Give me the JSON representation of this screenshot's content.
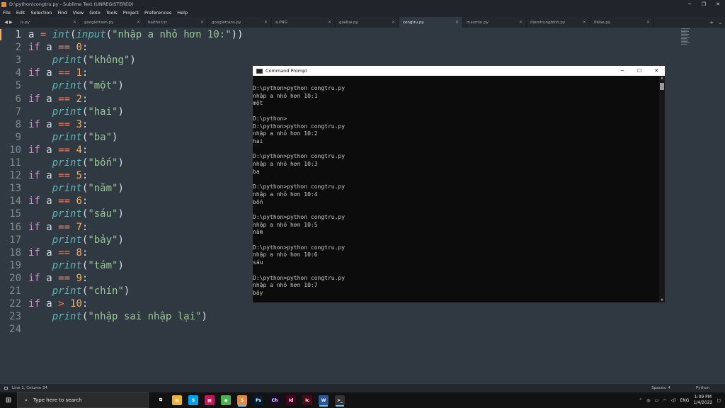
{
  "window": {
    "title": "D:\\python\\congtru.py - Sublime Text (UNREGISTERED)",
    "controls": [
      "─",
      "❐",
      "✕"
    ]
  },
  "menu": [
    "File",
    "Edit",
    "Selection",
    "Find",
    "View",
    "Goto",
    "Tools",
    "Project",
    "Preferences",
    "Help"
  ],
  "tabs": [
    {
      "label": "ls.py",
      "active": false
    },
    {
      "label": "googletrasn.py",
      "active": false
    },
    {
      "label": "baitho.txt",
      "active": false
    },
    {
      "label": "googletrans.py",
      "active": false
    },
    {
      "label": "a.PNG",
      "active": false
    },
    {
      "label": "giaibai.py",
      "active": false
    },
    {
      "label": "congtru.py",
      "active": true
    },
    {
      "label": "maxmin.py",
      "active": false
    },
    {
      "label": "diemtrungbinh.py",
      "active": false
    },
    {
      "label": "ifelse.py",
      "active": false
    }
  ],
  "editor": {
    "lines": [
      {
        "n": "1",
        "tokens": [
          [
            "plain",
            "a "
          ],
          [
            "op",
            "="
          ],
          [
            "plain",
            " "
          ],
          [
            "fn",
            "int"
          ],
          [
            "plain",
            "("
          ],
          [
            "fn",
            "input"
          ],
          [
            "plain",
            "("
          ],
          [
            "str",
            "\"nhập a nhỏ hơn 10:\""
          ],
          [
            "plain",
            "))"
          ]
        ]
      },
      {
        "n": "2",
        "tokens": [
          [
            "kw",
            "if"
          ],
          [
            "plain",
            " a "
          ],
          [
            "op",
            "=="
          ],
          [
            "plain",
            " "
          ],
          [
            "num",
            "0"
          ],
          [
            "plain",
            ":"
          ]
        ]
      },
      {
        "n": "3",
        "tokens": [
          [
            "plain",
            "    "
          ],
          [
            "fn",
            "print"
          ],
          [
            "plain",
            "("
          ],
          [
            "str",
            "\"không\""
          ],
          [
            "plain",
            ")"
          ]
        ]
      },
      {
        "n": "4",
        "tokens": [
          [
            "kw",
            "if"
          ],
          [
            "plain",
            " a "
          ],
          [
            "op",
            "=="
          ],
          [
            "plain",
            " "
          ],
          [
            "num",
            "1"
          ],
          [
            "plain",
            ":"
          ]
        ]
      },
      {
        "n": "5",
        "tokens": [
          [
            "plain",
            "    "
          ],
          [
            "fn",
            "print"
          ],
          [
            "plain",
            "("
          ],
          [
            "str",
            "\"một\""
          ],
          [
            "plain",
            ")"
          ]
        ]
      },
      {
        "n": "6",
        "tokens": [
          [
            "kw",
            "if"
          ],
          [
            "plain",
            " a "
          ],
          [
            "op",
            "=="
          ],
          [
            "plain",
            " "
          ],
          [
            "num",
            "2"
          ],
          [
            "plain",
            ":"
          ]
        ]
      },
      {
        "n": "7",
        "tokens": [
          [
            "plain",
            "    "
          ],
          [
            "fn",
            "print"
          ],
          [
            "plain",
            "("
          ],
          [
            "str",
            "\"hai\""
          ],
          [
            "plain",
            ")"
          ]
        ]
      },
      {
        "n": "8",
        "tokens": [
          [
            "kw",
            "if"
          ],
          [
            "plain",
            " a "
          ],
          [
            "op",
            "=="
          ],
          [
            "plain",
            " "
          ],
          [
            "num",
            "3"
          ],
          [
            "plain",
            ":"
          ]
        ]
      },
      {
        "n": "9",
        "tokens": [
          [
            "plain",
            "    "
          ],
          [
            "fn",
            "print"
          ],
          [
            "plain",
            "("
          ],
          [
            "str",
            "\"ba\""
          ],
          [
            "plain",
            ")"
          ]
        ]
      },
      {
        "n": "10",
        "tokens": [
          [
            "kw",
            "if"
          ],
          [
            "plain",
            " a "
          ],
          [
            "op",
            "=="
          ],
          [
            "plain",
            " "
          ],
          [
            "num",
            "4"
          ],
          [
            "plain",
            ":"
          ]
        ]
      },
      {
        "n": "11",
        "tokens": [
          [
            "plain",
            "    "
          ],
          [
            "fn",
            "print"
          ],
          [
            "plain",
            "("
          ],
          [
            "str",
            "\"bốn\""
          ],
          [
            "plain",
            ")"
          ]
        ]
      },
      {
        "n": "12",
        "tokens": [
          [
            "kw",
            "if"
          ],
          [
            "plain",
            " a "
          ],
          [
            "op",
            "=="
          ],
          [
            "plain",
            " "
          ],
          [
            "num",
            "5"
          ],
          [
            "plain",
            ":"
          ]
        ]
      },
      {
        "n": "13",
        "tokens": [
          [
            "plain",
            "    "
          ],
          [
            "fn",
            "print"
          ],
          [
            "plain",
            "("
          ],
          [
            "str",
            "\"năm\""
          ],
          [
            "plain",
            ")"
          ]
        ]
      },
      {
        "n": "14",
        "tokens": [
          [
            "kw",
            "if"
          ],
          [
            "plain",
            " a "
          ],
          [
            "op",
            "=="
          ],
          [
            "plain",
            " "
          ],
          [
            "num",
            "6"
          ],
          [
            "plain",
            ":"
          ]
        ]
      },
      {
        "n": "15",
        "tokens": [
          [
            "plain",
            "    "
          ],
          [
            "fn",
            "print"
          ],
          [
            "plain",
            "("
          ],
          [
            "str",
            "\"sáu\""
          ],
          [
            "plain",
            ")"
          ]
        ]
      },
      {
        "n": "16",
        "tokens": [
          [
            "kw",
            "if"
          ],
          [
            "plain",
            " a "
          ],
          [
            "op",
            "=="
          ],
          [
            "plain",
            " "
          ],
          [
            "num",
            "7"
          ],
          [
            "plain",
            ":"
          ]
        ]
      },
      {
        "n": "17",
        "tokens": [
          [
            "plain",
            "    "
          ],
          [
            "fn",
            "print"
          ],
          [
            "plain",
            "("
          ],
          [
            "str",
            "\"bảy\""
          ],
          [
            "plain",
            ")"
          ]
        ]
      },
      {
        "n": "18",
        "tokens": [
          [
            "kw",
            "if"
          ],
          [
            "plain",
            " a "
          ],
          [
            "op",
            "=="
          ],
          [
            "plain",
            " "
          ],
          [
            "num",
            "8"
          ],
          [
            "plain",
            ":"
          ]
        ]
      },
      {
        "n": "19",
        "tokens": [
          [
            "plain",
            "    "
          ],
          [
            "fn",
            "print"
          ],
          [
            "plain",
            "("
          ],
          [
            "str",
            "\"tám\""
          ],
          [
            "plain",
            ")"
          ]
        ]
      },
      {
        "n": "20",
        "tokens": [
          [
            "kw",
            "if"
          ],
          [
            "plain",
            " a "
          ],
          [
            "op",
            "=="
          ],
          [
            "plain",
            " "
          ],
          [
            "num",
            "9"
          ],
          [
            "plain",
            ":"
          ]
        ]
      },
      {
        "n": "21",
        "tokens": [
          [
            "plain",
            "    "
          ],
          [
            "fn",
            "print"
          ],
          [
            "plain",
            "("
          ],
          [
            "str",
            "\"chín\""
          ],
          [
            "plain",
            ")"
          ]
        ]
      },
      {
        "n": "22",
        "tokens": [
          [
            "kw",
            "if"
          ],
          [
            "plain",
            " a "
          ],
          [
            "op",
            ">"
          ],
          [
            "plain",
            " "
          ],
          [
            "num",
            "10"
          ],
          [
            "plain",
            ":"
          ]
        ]
      },
      {
        "n": "23",
        "tokens": [
          [
            "plain",
            "    "
          ],
          [
            "fn",
            "print"
          ],
          [
            "plain",
            "("
          ],
          [
            "str",
            "\"nhập sai nhập lại\""
          ],
          [
            "plain",
            ")"
          ]
        ]
      },
      {
        "n": "24",
        "tokens": []
      }
    ]
  },
  "cmd": {
    "title": "Command Prompt",
    "controls": [
      "─",
      "☐",
      "✕"
    ],
    "output": "D:\\python>python congtru.py\nnhập a nhỏ hơn 10:1\nmột\n\nD:\\python>\nD:\\python>python congtru.py\nnhập a nhỏ hơn 10:2\nhai\n\nD:\\python>python congtru.py\nnhập a nhỏ hơn 10:3\nba\n\nD:\\python>python congtru.py\nnhập a nhỏ hơn 10:4\nbốn\n\nD:\\python>python congtru.py\nnhập a nhỏ hơn 10:5\nnăm\n\nD:\\python>python congtru.py\nnhập a nhỏ hơn 10:6\nsáu\n\nD:\\python>python congtru.py\nnhập a nhỏ hơn 10:7\nbảy"
  },
  "status": {
    "position": "Line 1, Column 34",
    "spaces": "Spaces: 4",
    "syntax": "Python"
  },
  "taskbar": {
    "search_placeholder": "Type here to search",
    "apps": [
      {
        "label": "⧉",
        "color": "#121212",
        "active": false
      },
      {
        "label": "▤",
        "color": "#e8b339",
        "active": false
      },
      {
        "label": "S",
        "color": "#00a2ed",
        "active": false
      },
      {
        "label": "▦",
        "color": "#c2185b",
        "active": false
      },
      {
        "label": "◉",
        "color": "#4caf50",
        "active": false
      },
      {
        "label": "S",
        "color": "#e08b3e",
        "active": true
      },
      {
        "label": "Ps",
        "color": "#001d34",
        "active": false
      },
      {
        "label": "Ch",
        "color": "#1a0a33",
        "active": false
      },
      {
        "label": "Id",
        "color": "#49021f",
        "active": false
      },
      {
        "label": "Ic",
        "color": "#4a0a1a",
        "active": false
      },
      {
        "label": "W",
        "color": "#2b579a",
        "active": true
      },
      {
        "label": ">_",
        "color": "#333333",
        "active": true
      }
    ],
    "lang": "ENG",
    "time": "1:09 PM",
    "date": "1/4/2022"
  }
}
